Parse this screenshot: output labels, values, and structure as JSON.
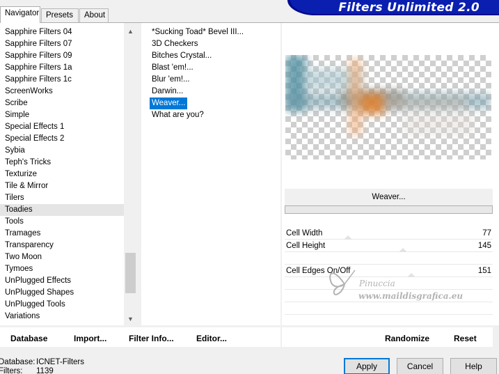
{
  "tabs": [
    "Navigator",
    "Presets",
    "About"
  ],
  "banner_title": "Filters Unlimited 2.0",
  "categories": [
    "Sapphire Filters 04",
    "Sapphire Filters 07",
    "Sapphire Filters 09",
    "Sapphire Filters 1a",
    "Sapphire Filters 1c",
    "ScreenWorks",
    "Scribe",
    "Simple",
    "Special Effects 1",
    "Special Effects 2",
    "Sybia",
    "Teph's Tricks",
    "Texturize",
    "Tile & Mirror",
    "Tilers",
    "Toadies",
    "Tools",
    "Tramages",
    "Transparency",
    "Two Moon",
    "Tymoes",
    "UnPlugged Effects",
    "UnPlugged Shapes",
    "UnPlugged Tools",
    "Variations"
  ],
  "selected_category": "Toadies",
  "filters": [
    "*Sucking Toad*  Bevel III...",
    "3D Checkers",
    "Bitches Crystal...",
    "Blast 'em!...",
    "Blur 'em!...",
    "Darwin...",
    "Weaver...",
    "What are you?"
  ],
  "selected_filter": "Weaver...",
  "current_filter_label": "Weaver...",
  "params": [
    {
      "label": "Cell Width",
      "value": "77"
    },
    {
      "label": "Cell Height",
      "value": "145"
    },
    {
      "label": "Cell Edges On/Off",
      "value": "151"
    }
  ],
  "watermark": {
    "name": "Pinuccia",
    "url": "www.maildisgrafica.eu"
  },
  "bottom_links": {
    "database": "Database",
    "import": "Import...",
    "filter_info": "Filter Info...",
    "editor": "Editor...",
    "randomize": "Randomize",
    "reset": "Reset"
  },
  "status": {
    "database_label": "Database:",
    "database_value": "ICNET-Filters",
    "filters_label": "Filters:",
    "filters_value": "1139"
  },
  "buttons": {
    "apply": "Apply",
    "cancel": "Cancel",
    "help": "Help"
  }
}
